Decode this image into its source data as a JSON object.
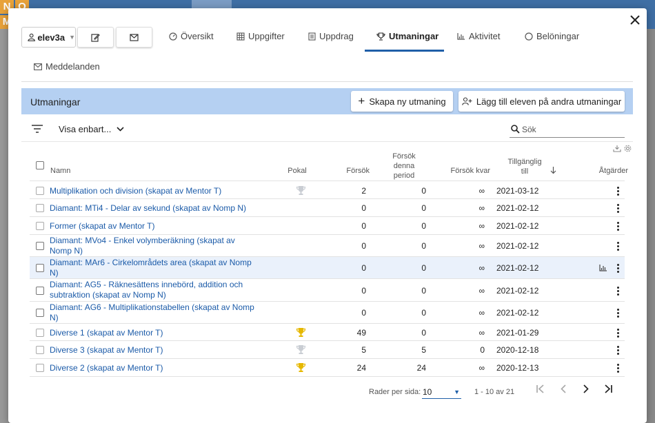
{
  "background": {
    "tiles": [
      "N",
      "O",
      "M"
    ]
  },
  "dialog": {
    "close_icon": "close-icon"
  },
  "toolbar": {
    "user": "elev3a",
    "edit_icon": "edit-icon",
    "mail_icon": "mail-icon"
  },
  "tabs": [
    {
      "label": "Översikt",
      "icon": "gauge-icon"
    },
    {
      "label": "Uppgifter",
      "icon": "grid-icon"
    },
    {
      "label": "Uppdrag",
      "icon": "document-icon"
    },
    {
      "label": "Utmaningar",
      "icon": "trophy-icon",
      "active": true
    },
    {
      "label": "Aktivitet",
      "icon": "chart-icon"
    },
    {
      "label": "Belöningar",
      "icon": "circle-icon"
    },
    {
      "label": "Meddelanden",
      "icon": "mail-icon"
    }
  ],
  "header": {
    "title": "Utmaningar",
    "create_button": "Skapa ny utmaning",
    "add_button": "Lägg till eleven på andra utmaningar"
  },
  "filter": {
    "label": "Visa enbart...",
    "search_placeholder": "Sök"
  },
  "table": {
    "columns": {
      "name": "Namn",
      "pokal": "Pokal",
      "attempts": "Försök",
      "attempts_period": "Försök denna period",
      "attempts_left": "Försök kvar",
      "available": "Tillgänglig till",
      "actions": "Åtgärder"
    },
    "rows": [
      {
        "name": "Multiplikation och division (skapat av Mentor T)",
        "trophy": "silver",
        "attempts": "2",
        "period": "0",
        "left": "∞",
        "date": "2021-03-12"
      },
      {
        "name": "Diamant: MTi4 - Delar av sekund (skapat av Nomp N)",
        "trophy": "",
        "attempts": "0",
        "period": "0",
        "left": "∞",
        "date": "2021-02-12"
      },
      {
        "name": "Former (skapat av Mentor T)",
        "trophy": "",
        "attempts": "0",
        "period": "0",
        "left": "∞",
        "date": "2021-02-12"
      },
      {
        "name": "Diamant: MVo4 - Enkel volymberäkning (skapat av Nomp N)",
        "trophy": "",
        "attempts": "0",
        "period": "0",
        "left": "∞",
        "date": "2021-02-12"
      },
      {
        "name": "Diamant: MAr6 - Cirkelområdets area (skapat av Nomp N)",
        "trophy": "",
        "attempts": "0",
        "period": "0",
        "left": "∞",
        "date": "2021-02-12",
        "highlight": true
      },
      {
        "name": "Diamant: AG5 - Räknesättens innebörd, addition och subtraktion (skapat av Nomp N)",
        "trophy": "",
        "attempts": "0",
        "period": "0",
        "left": "∞",
        "date": "2021-02-12"
      },
      {
        "name": "Diamant: AG6 - Multiplikationstabellen (skapat av Nomp N)",
        "trophy": "",
        "attempts": "0",
        "period": "0",
        "left": "∞",
        "date": "2021-02-12"
      },
      {
        "name": "Diverse 1 (skapat av Mentor T)",
        "trophy": "gold",
        "attempts": "49",
        "period": "0",
        "left": "∞",
        "date": "2021-01-29"
      },
      {
        "name": "Diverse 3 (skapat av Mentor T)",
        "trophy": "silver",
        "attempts": "5",
        "period": "5",
        "left": "0",
        "date": "2020-12-18"
      },
      {
        "name": "Diverse 2 (skapat av Mentor T)",
        "trophy": "gold",
        "attempts": "24",
        "period": "24",
        "left": "∞",
        "date": "2020-12-13"
      }
    ]
  },
  "pagination": {
    "rows_per_page_label": "Rader per sida:",
    "rows_per_page": "10",
    "range": "1 - 10 av 21"
  },
  "colors": {
    "accent": "#1f5fa8",
    "header_bg": "#b5d0f2",
    "gold": "#e6b800",
    "silver": "#c9cdd3"
  }
}
